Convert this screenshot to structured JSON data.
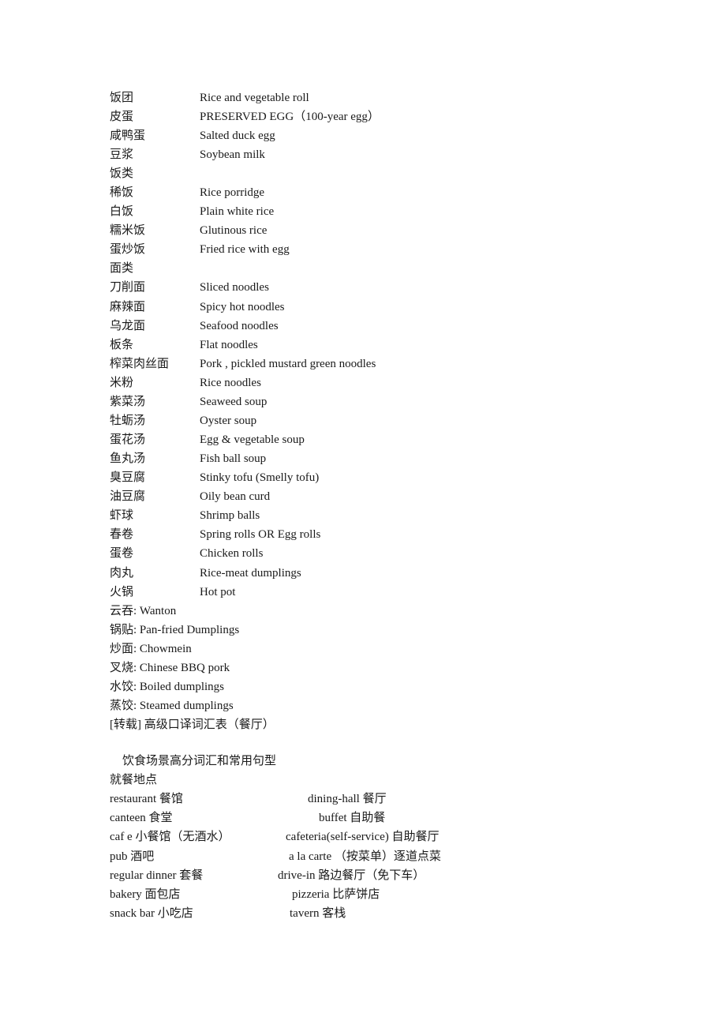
{
  "glossary": [
    {
      "zh": "饭团",
      "en": "Rice and vegetable roll"
    },
    {
      "zh": "皮蛋",
      "en": "PRESERVED EGG（100-year egg）"
    },
    {
      "zh": "咸鸭蛋",
      "en": "Salted duck egg"
    },
    {
      "zh": "豆浆",
      "en": "Soybean milk"
    },
    {
      "zh": "饭类",
      "en": ""
    },
    {
      "zh": "稀饭",
      "en": "Rice porridge"
    },
    {
      "zh": "白饭",
      "en": "Plain white rice"
    },
    {
      "zh": "糯米饭",
      "en": "Glutinous rice"
    },
    {
      "zh": "蛋炒饭",
      "en": "Fried rice with egg"
    },
    {
      "zh": "面类",
      "en": ""
    },
    {
      "zh": "刀削面",
      "en": "Sliced noodles"
    },
    {
      "zh": "麻辣面",
      "en": "Spicy hot noodles"
    },
    {
      "zh": "乌龙面",
      "en": "Seafood noodles"
    },
    {
      "zh": "板条",
      "en": "Flat noodles"
    },
    {
      "zh": "榨菜肉丝面",
      "en": "Pork , pickled mustard green noodles"
    },
    {
      "zh": "米粉",
      "en": "Rice noodles"
    },
    {
      "zh": "紫菜汤",
      "en": "Seaweed soup"
    },
    {
      "zh": "牡蛎汤",
      "en": "Oyster soup"
    },
    {
      "zh": "蛋花汤",
      "en": "Egg & vegetable soup"
    },
    {
      "zh": "鱼丸汤",
      "en": "Fish ball soup"
    },
    {
      "zh": "臭豆腐",
      "en": "Stinky tofu (Smelly tofu)"
    },
    {
      "zh": "油豆腐",
      "en": "Oily bean curd"
    },
    {
      "zh": "虾球",
      "en": "Shrimp balls"
    },
    {
      "zh": "春卷",
      "en": "Spring rolls OR Egg rolls"
    },
    {
      "zh": "蛋卷",
      "en": "Chicken rolls"
    },
    {
      "zh": "肉丸",
      "en": "Rice-meat dumplings"
    },
    {
      "zh": "火锅",
      "en": "Hot pot"
    }
  ],
  "colon_items": [
    "云吞: Wanton",
    "锅贴: Pan-fried Dumplings",
    "炒面: Chowmein",
    "叉烧: Chinese BBQ pork",
    "水饺: Boiled dumplings",
    "蒸饺: Steamed dumplings"
  ],
  "repost_title": "[转载] 高级口译词汇表（餐厅）",
  "section_title": "饮食场景高分词汇和常用句型",
  "subsection_title": "就餐地点",
  "places": [
    {
      "left": "restaurant 餐馆",
      "right": "dining-hall 餐厅"
    },
    {
      "left": "canteen 食堂",
      "right": "buffet 自助餐"
    },
    {
      "left": "caf e  小餐馆（无酒水）",
      "right": "cafeteria(self-service) 自助餐厅"
    },
    {
      "left": "pub 酒吧",
      "right": "a la carte （按菜单）逐道点菜"
    },
    {
      "left": "regular dinner 套餐",
      "right": "drive-in 路边餐厅（免下车）"
    },
    {
      "left": "bakery 面包店",
      "right": "pizzeria 比萨饼店"
    },
    {
      "left": "snack bar 小吃店",
      "right": "tavern 客栈"
    }
  ]
}
